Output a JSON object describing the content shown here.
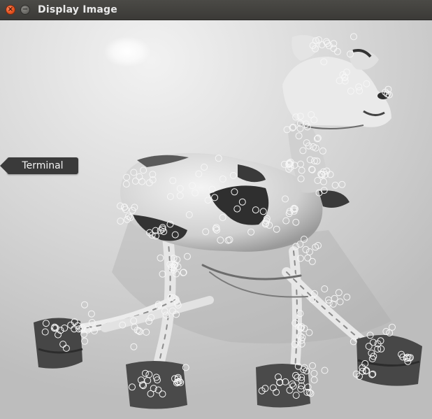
{
  "window": {
    "title": "Display Image"
  },
  "controls": {
    "close_glyph": "×",
    "minimize_glyph": "−"
  },
  "tooltip": {
    "label": "Terminal"
  }
}
